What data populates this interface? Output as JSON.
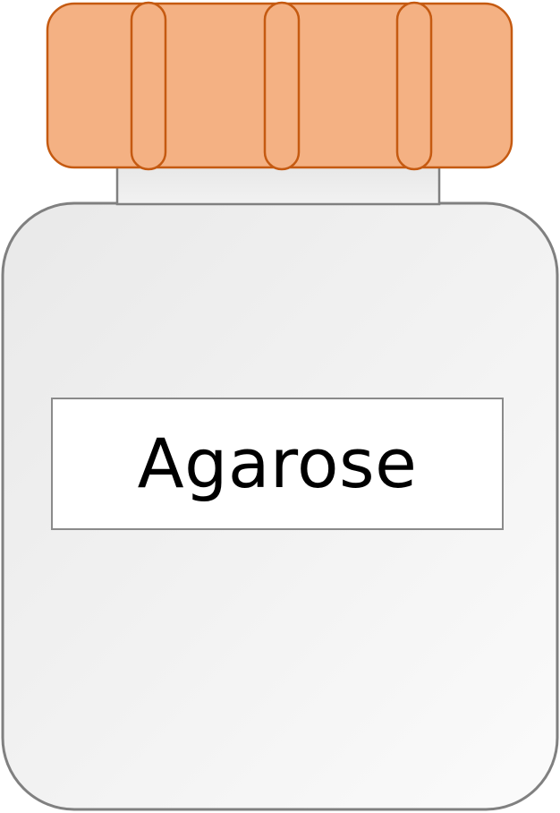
{
  "jar": {
    "label": "Agarose",
    "colors": {
      "cap_fill": "#f4b183",
      "cap_stroke": "#c55a11",
      "body_fill_light": "#fafafa",
      "body_fill_dark": "#e8e8e8",
      "body_stroke": "#808080",
      "neck_fill": "#ececec",
      "label_fill": "#ffffff",
      "label_stroke": "#8a8a8a",
      "text": "#000000"
    },
    "cap_rib_count": 3
  }
}
